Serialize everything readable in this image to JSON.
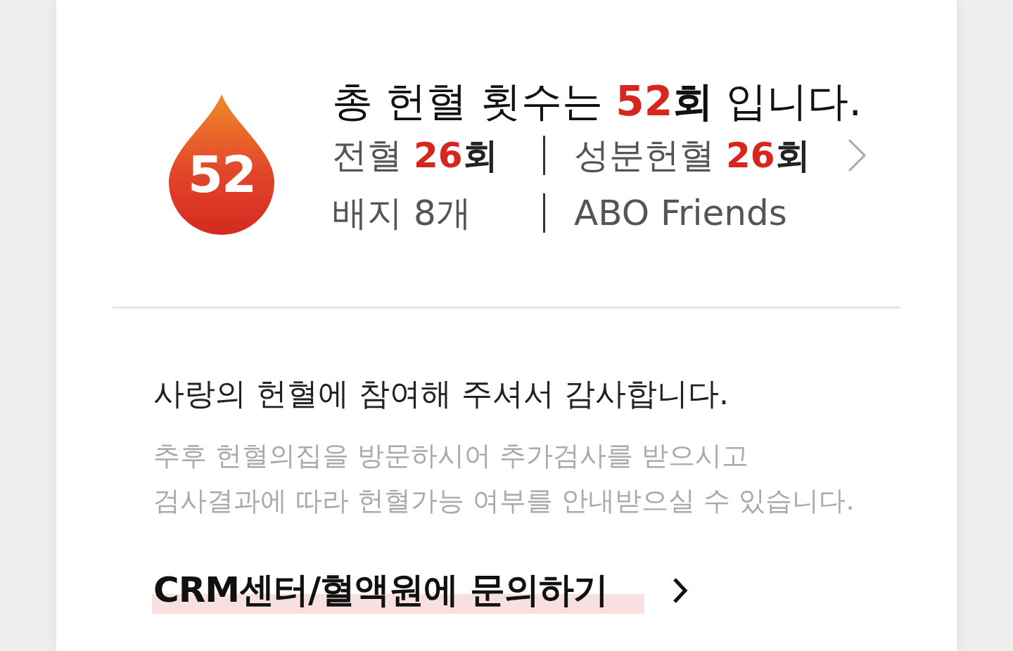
{
  "summary": {
    "badge_number": "52",
    "title_prefix": "총 헌혈 횟수는",
    "title_count": "52",
    "title_unit": "회",
    "title_suffix": "입니다."
  },
  "stats": [
    {
      "label": "전혈",
      "count": "26",
      "unit": "회"
    },
    {
      "label": "성분헌혈",
      "count": "26",
      "unit": "회"
    }
  ],
  "badges": {
    "label": "배지 8개",
    "value": "ABO Friends"
  },
  "message": "사랑의 헌혈에 참여해 주셔서 감사합니다.",
  "notice": [
    "추후 헌혈의집을 방문하시어 추가검사를 받으시고",
    "검사결과에 따라 헌혈가능 여부를 안내받으실 수 있습니다."
  ],
  "contact_link": "CRM센터/혈액원에 문의하기"
}
